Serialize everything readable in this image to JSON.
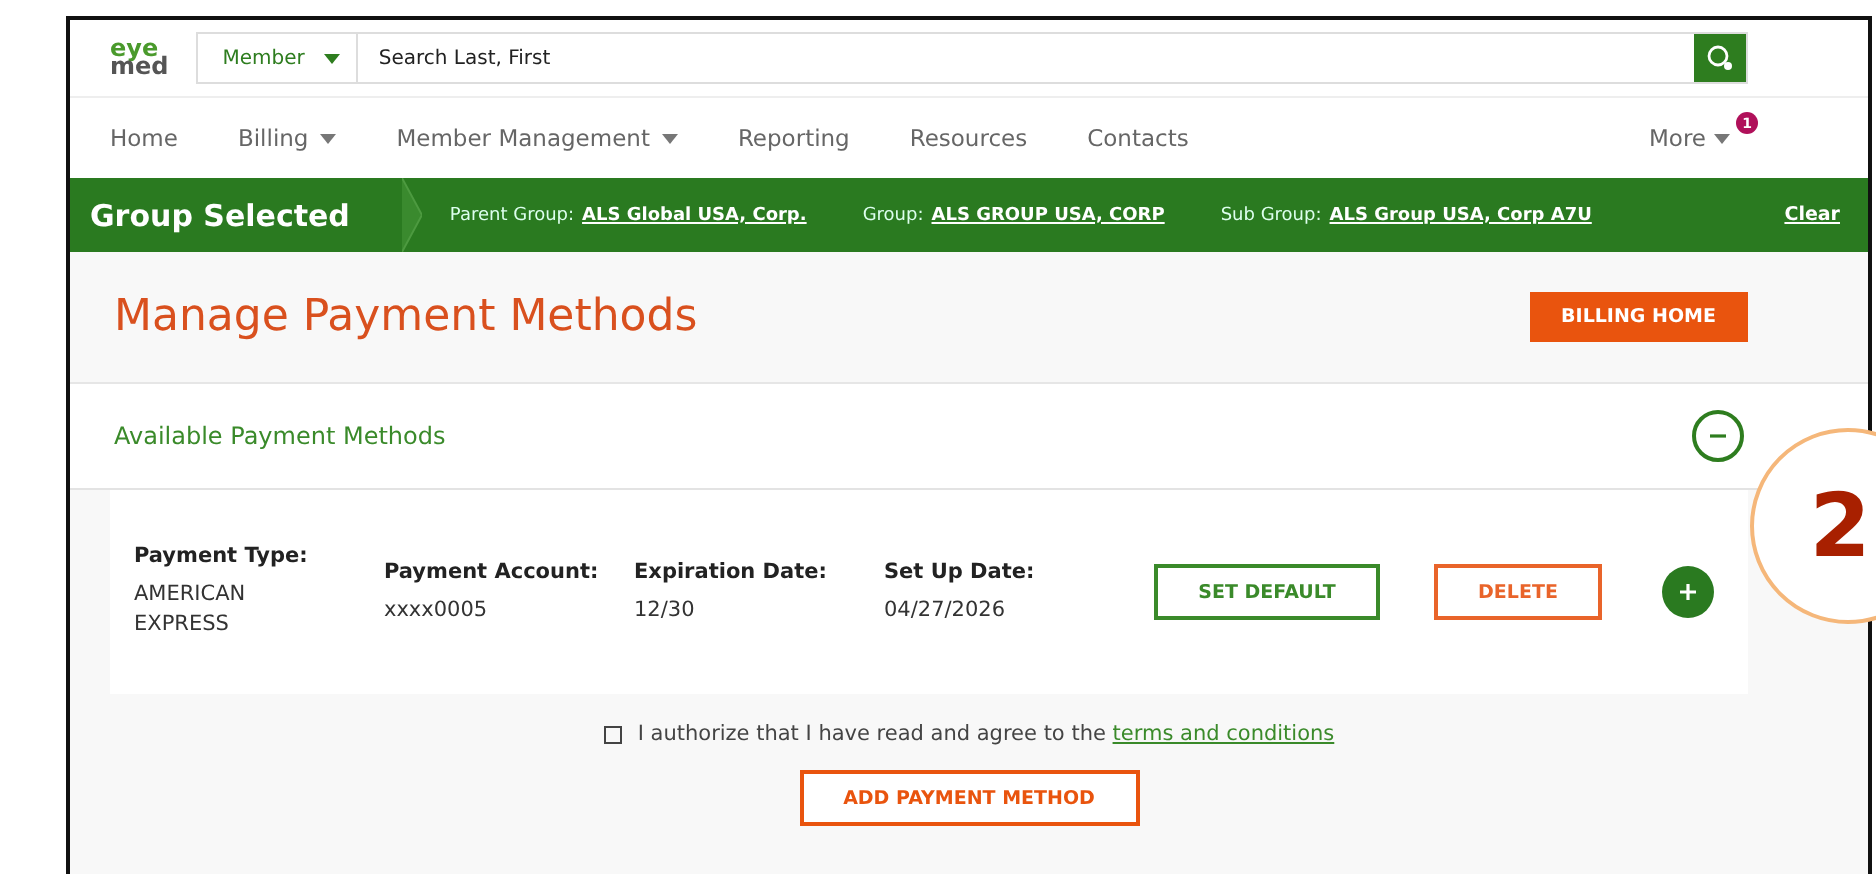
{
  "header": {
    "logo": [
      "eye",
      "med"
    ],
    "search": {
      "scope": "Member",
      "placeholder": "Search Last, First"
    }
  },
  "nav": {
    "items": [
      {
        "label": "Home",
        "has_menu": false
      },
      {
        "label": "Billing",
        "has_menu": true
      },
      {
        "label": "Member Management",
        "has_menu": true
      },
      {
        "label": "Reporting",
        "has_menu": false
      },
      {
        "label": "Resources",
        "has_menu": false
      },
      {
        "label": "Contacts",
        "has_menu": false
      }
    ],
    "more": {
      "label": "More",
      "badge": "1"
    }
  },
  "group_bar": {
    "title": "Group Selected",
    "fields": [
      {
        "label": "Parent Group:",
        "value": "ALS Global USA, Corp."
      },
      {
        "label": "Group:",
        "value": "ALS GROUP USA, CORP"
      },
      {
        "label": "Sub Group:",
        "value": "ALS Group USA, Corp A7U"
      }
    ],
    "clear": "Clear"
  },
  "page": {
    "title": "Manage Payment Methods",
    "billing_home": "BILLING HOME"
  },
  "section": {
    "title": "Available Payment Methods",
    "expanded": true
  },
  "payment_methods": [
    {
      "columns": [
        {
          "label": "Payment Type:",
          "value": "AMERICAN EXPRESS"
        },
        {
          "label": "Payment Account:",
          "value": "xxxx0005"
        },
        {
          "label": "Expiration Date:",
          "value": "12/30"
        },
        {
          "label": "Set Up Date:",
          "value": "04/27/2026"
        }
      ],
      "set_default": "SET DEFAULT",
      "delete": "DELETE"
    }
  ],
  "authorize": {
    "checked": false,
    "text": "I authorize that I have read and agree to the",
    "link": "terms and conditions"
  },
  "add_button": "ADD PAYMENT METHOD",
  "callout": "2"
}
